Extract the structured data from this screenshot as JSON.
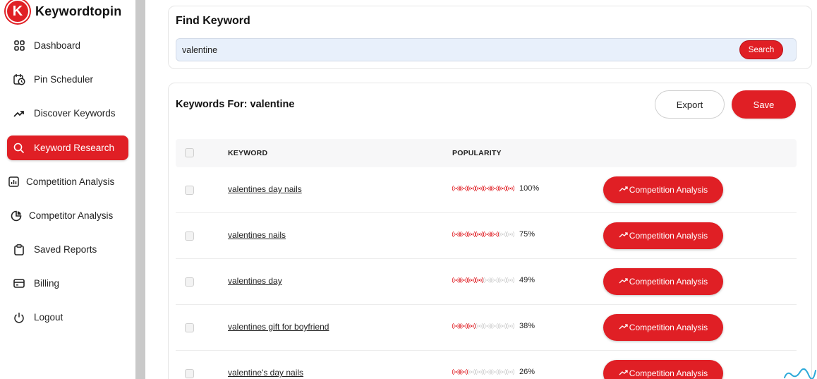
{
  "brand": {
    "name": "Keywordtopin",
    "logo_letter": "K",
    "accent": "#e01f25"
  },
  "sidebar": {
    "items": [
      {
        "label": "Dashboard",
        "icon": "grid-icon",
        "active": false
      },
      {
        "label": "Pin Scheduler",
        "icon": "calendar-clock-icon",
        "active": false
      },
      {
        "label": "Discover Keywords",
        "icon": "trend-icon",
        "active": false
      },
      {
        "label": "Keyword Research",
        "icon": "search-icon",
        "active": true
      },
      {
        "label": "Competition Analysis",
        "icon": "bar-chart-icon",
        "active": false
      },
      {
        "label": "Competitor Analysis",
        "icon": "pie-chart-icon",
        "active": false
      },
      {
        "label": "Saved Reports",
        "icon": "clipboard-icon",
        "active": false
      },
      {
        "label": "Billing",
        "icon": "credit-card-icon",
        "active": false
      },
      {
        "label": "Logout",
        "icon": "power-icon",
        "active": false
      }
    ]
  },
  "find": {
    "title": "Find Keyword",
    "query": "valentine",
    "search_label": "Search"
  },
  "results": {
    "title": "Keywords For: valentine",
    "export_label": "Export",
    "save_label": "Save",
    "columns": {
      "keyword": "KEYWORD",
      "popularity": "POPULARITY"
    },
    "action_label": "Competition Analysis",
    "rows": [
      {
        "keyword": "valentines day nails",
        "popularity": "100%",
        "level": 8
      },
      {
        "keyword": "valentines nails",
        "popularity": "75%",
        "level": 6
      },
      {
        "keyword": "valentines day",
        "popularity": "49%",
        "level": 4
      },
      {
        "keyword": "valentines gift for boyfriend",
        "popularity": "38%",
        "level": 3
      },
      {
        "keyword": "valentine's day nails",
        "popularity": "26%",
        "level": 2
      }
    ]
  }
}
